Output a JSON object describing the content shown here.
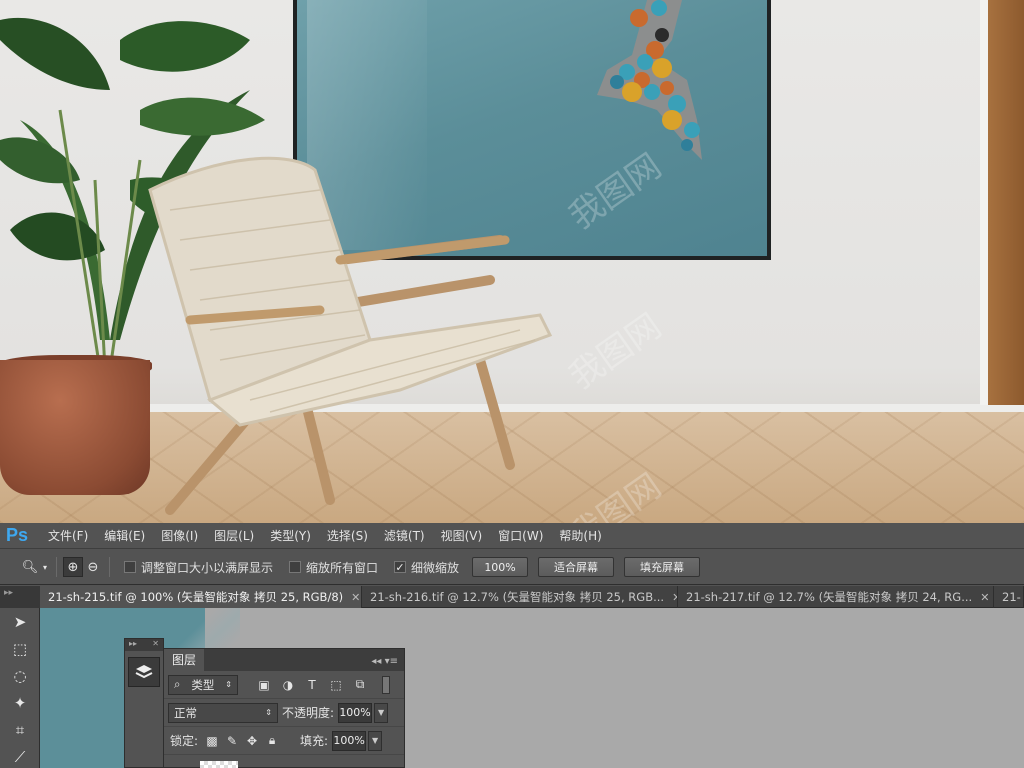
{
  "menubar": {
    "logo": "Ps",
    "items": [
      "文件(F)",
      "编辑(E)",
      "图像(I)",
      "图层(L)",
      "类型(Y)",
      "选择(S)",
      "滤镜(T)",
      "视图(V)",
      "窗口(W)",
      "帮助(H)"
    ]
  },
  "options": {
    "resize_windows": "调整窗口大小以满屏显示",
    "zoom_all": "缩放所有窗口",
    "scrubby_zoom": "细微缩放",
    "scrubby_zoom_checked": true,
    "btn_100": "100%",
    "btn_fit": "适合屏幕",
    "btn_fill": "填充屏幕"
  },
  "tabs": [
    {
      "label": "21-sh-215.tif @ 100% (矢量智能对象 拷贝 25, RGB/8)",
      "active": true
    },
    {
      "label": "21-sh-216.tif @ 12.7% (矢量智能对象 拷贝 25, RGB...",
      "active": false
    },
    {
      "label": "21-sh-217.tif @ 12.7% (矢量智能对象 拷贝 24, RG...",
      "active": false
    },
    {
      "label": "21-",
      "active": false
    }
  ],
  "layers_panel": {
    "title": "图层",
    "filter_type": "类型",
    "blend_mode": "正常",
    "opacity_label": "不透明度:",
    "opacity_value": "100%",
    "lock_label": "锁定:",
    "fill_label": "填充:",
    "fill_value": "100%"
  },
  "colors": {
    "ps_blue": "#3ea8f0",
    "ui_bg": "#535353",
    "canvas_teal": "#5c8f99"
  }
}
